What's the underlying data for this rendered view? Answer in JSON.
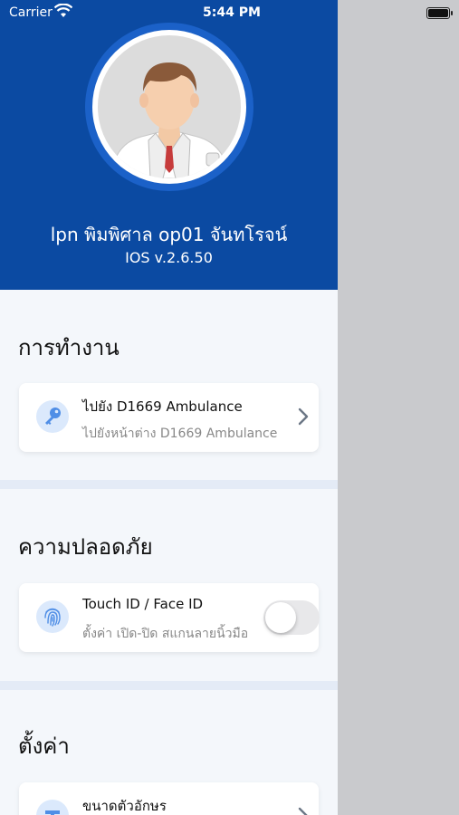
{
  "status_bar": {
    "carrier": "Carrier",
    "time": "5:44 PM"
  },
  "profile": {
    "name": "lpn พิมพิศาล op01 จันทโรจน์",
    "version": "IOS v.2.6.50"
  },
  "sections": {
    "work": {
      "title": "การทำงาน",
      "item": {
        "title": "ไปยัง D1669 Ambulance",
        "subtitle": "ไปยังหน้าต่าง D1669 Ambulance",
        "icon": "key-icon"
      }
    },
    "security": {
      "title": "ความปลอดภัย",
      "item": {
        "title": "Touch ID / Face ID",
        "subtitle": "ตั้งค่า เปิด-ปิด สแกนลายนิ้วมือ",
        "icon": "fingerprint-icon",
        "toggle_on": false
      }
    },
    "settings": {
      "title": "ตั้งค่า",
      "item": {
        "title": "ขนาดตัวอักษร",
        "icon": "font-size-icon"
      }
    }
  },
  "colors": {
    "header": "#0b4aa2",
    "accent": "#1b61c8",
    "icon_bg": "#dbe9fc",
    "background": "#f4f7fb"
  }
}
